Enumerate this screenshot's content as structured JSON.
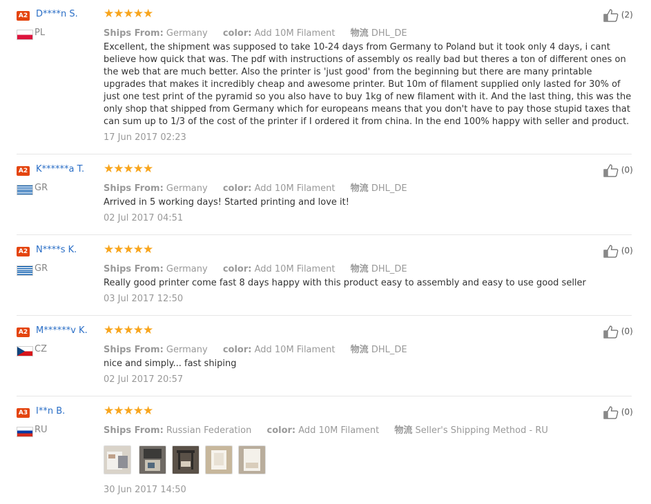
{
  "reviews": [
    {
      "level": "A2",
      "username": "D****n S.",
      "country": "PL",
      "stars": "★★★★★",
      "ships_from_label": "Ships From:",
      "ships_from": "Germany",
      "color_label": "color:",
      "color": "Add 10M Filament",
      "logistics_label": "物流",
      "logistics": "DHL_DE",
      "text": "Excellent, the shipment was supposed to take 10-24 days from Germany to Poland but it took only 4 days, i cant believe how quick that was. The pdf with instructions of assembly os really bad but theres a ton of different ones on the web that are much better. Also the printer is 'just good' from the beginning but there are many printable upgrades that makes it incredibly cheap and awesome printer. But 10m of filament supplied only lasted for 30% of just one test print of the pyramid so you also have to buy 1kg of new filament with it. And the last thing, this was the only shop that shipped from Germany which for europeans means that you don't have to pay those stupid taxes that can sum up to 1/3 of the cost of the printer if I ordered it from china. In the end 100% happy with seller and product.",
      "date": "17 Jun 2017 02:23",
      "likes": "(2)"
    },
    {
      "level": "A2",
      "username": "K******a T.",
      "country": "GR",
      "stars": "★★★★★",
      "ships_from_label": "Ships From:",
      "ships_from": "Germany",
      "color_label": "color:",
      "color": "Add 10M Filament",
      "logistics_label": "物流",
      "logistics": "DHL_DE",
      "text": "Arrived in 5 working days! Started printing and love it!",
      "date": "02 Jul 2017 04:51",
      "likes": "(0)"
    },
    {
      "level": "A2",
      "username": "N****s K.",
      "country": "GR",
      "stars": "★★★★★",
      "ships_from_label": "Ships From:",
      "ships_from": "Germany",
      "color_label": "color:",
      "color": "Add 10M Filament",
      "logistics_label": "物流",
      "logistics": "DHL_DE",
      "text": "Really good printer come fast 8 days happy with this product easy to assembly and easy to use good seller",
      "date": "03 Jul 2017 12:50",
      "likes": "(0)"
    },
    {
      "level": "A2",
      "username": "M******v K.",
      "country": "CZ",
      "stars": "★★★★★",
      "ships_from_label": "Ships From:",
      "ships_from": "Germany",
      "color_label": "color:",
      "color": "Add 10M Filament",
      "logistics_label": "物流",
      "logistics": "DHL_DE",
      "text": "nice and simply... fast shiping",
      "date": "02 Jul 2017 20:57",
      "likes": "(0)"
    },
    {
      "level": "A3",
      "username": "I**n B.",
      "country": "RU",
      "stars": "★★★★★",
      "ships_from_label": "Ships From:",
      "ships_from": "Russian Federation",
      "color_label": "color:",
      "color": "Add 10M Filament",
      "logistics_label": "物流",
      "logistics": "Seller's Shipping Method - RU",
      "text": "",
      "date": "30 Jun 2017 14:50",
      "likes": "(0)"
    }
  ],
  "colors": {
    "link": "#2a6ec6",
    "star": "#f8a51d",
    "badge": "#e4450f",
    "muted": "#999999"
  },
  "icons": {
    "like": "thumbs-up-icon",
    "star": "star-icon"
  }
}
